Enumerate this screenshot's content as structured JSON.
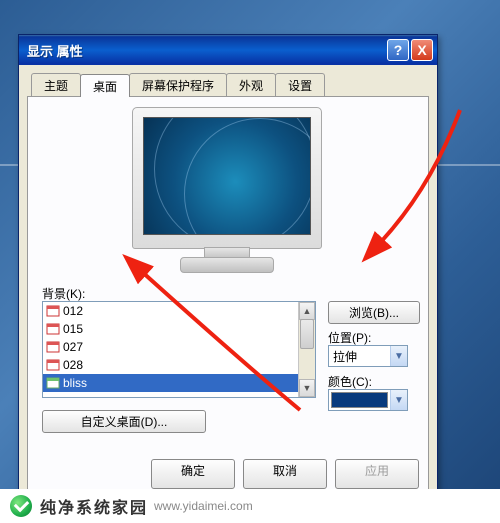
{
  "window": {
    "title": "显示 属性"
  },
  "tabs": {
    "t0": "主题",
    "t1": "桌面",
    "t2": "屏幕保护程序",
    "t3": "外观",
    "t4": "设置"
  },
  "labels": {
    "background": "背景(K):",
    "position": "位置(P):",
    "color": "颜色(C):"
  },
  "buttons": {
    "browse": "浏览(B)...",
    "customize": "自定义桌面(D)...",
    "ok": "确定",
    "cancel": "取消",
    "apply": "应用"
  },
  "position_select": {
    "value": "拉伸"
  },
  "color_select": {
    "value": "#083a7d"
  },
  "background_list": {
    "items": [
      {
        "name": "012",
        "selected": false
      },
      {
        "name": "015",
        "selected": false
      },
      {
        "name": "027",
        "selected": false
      },
      {
        "name": "028",
        "selected": false
      },
      {
        "name": "bliss",
        "selected": true
      }
    ]
  },
  "titlebar_buttons": {
    "help": "?",
    "close": "X"
  },
  "footer": {
    "brand": "纯净系统家园",
    "url": "www.yidaimei.com"
  }
}
